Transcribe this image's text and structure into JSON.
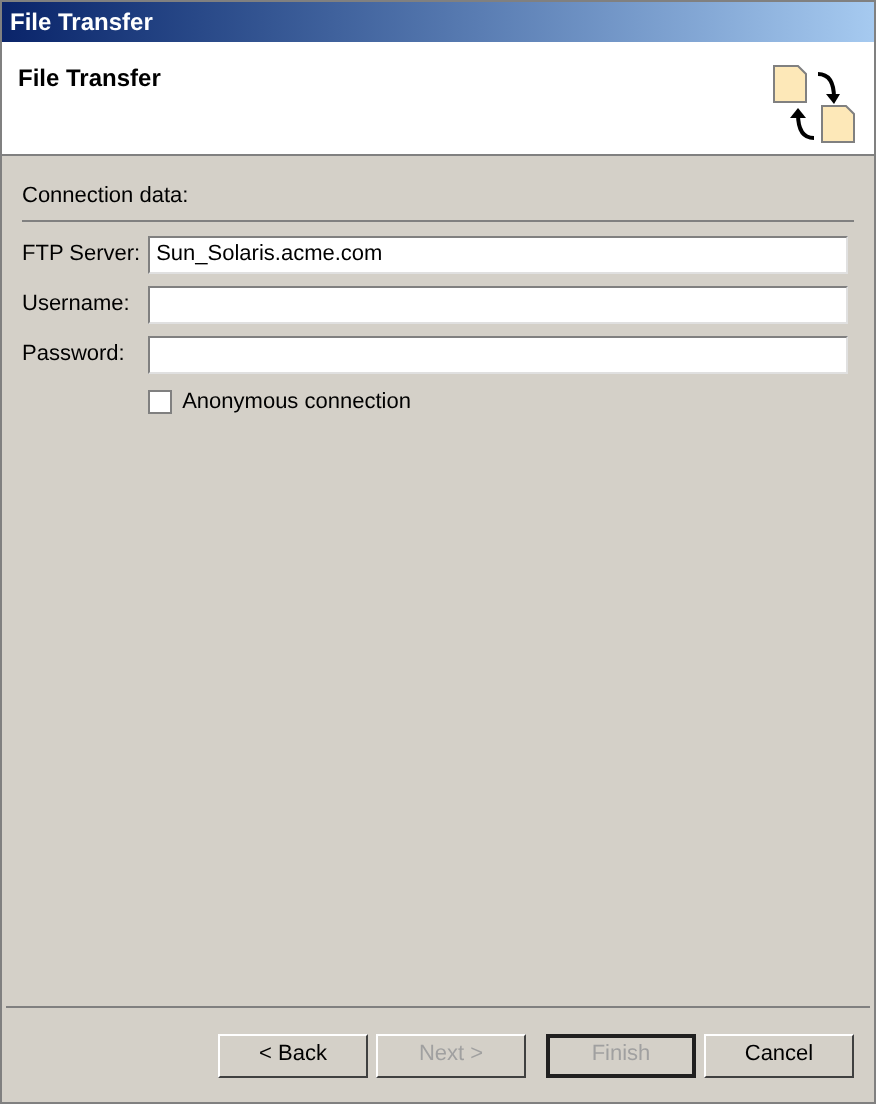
{
  "window": {
    "title": "File Transfer"
  },
  "header": {
    "title": "File Transfer"
  },
  "group": {
    "label": "Connection data:"
  },
  "fields": [
    {
      "label": "FTP Server:",
      "value": "Sun_Solaris.acme.com"
    },
    {
      "label": "Username:"
    },
    {
      "label": "Password:"
    }
  ],
  "checkbox": {
    "label": "Anonymous connection",
    "checked": false
  },
  "buttons": [
    {
      "label": "< Back",
      "disabled": false,
      "default": false
    },
    {
      "label": "Next >",
      "disabled": true,
      "default": false
    },
    {
      "label": "Finish",
      "disabled": true,
      "default": true
    },
    {
      "label": "Cancel",
      "disabled": false,
      "default": false
    }
  ]
}
